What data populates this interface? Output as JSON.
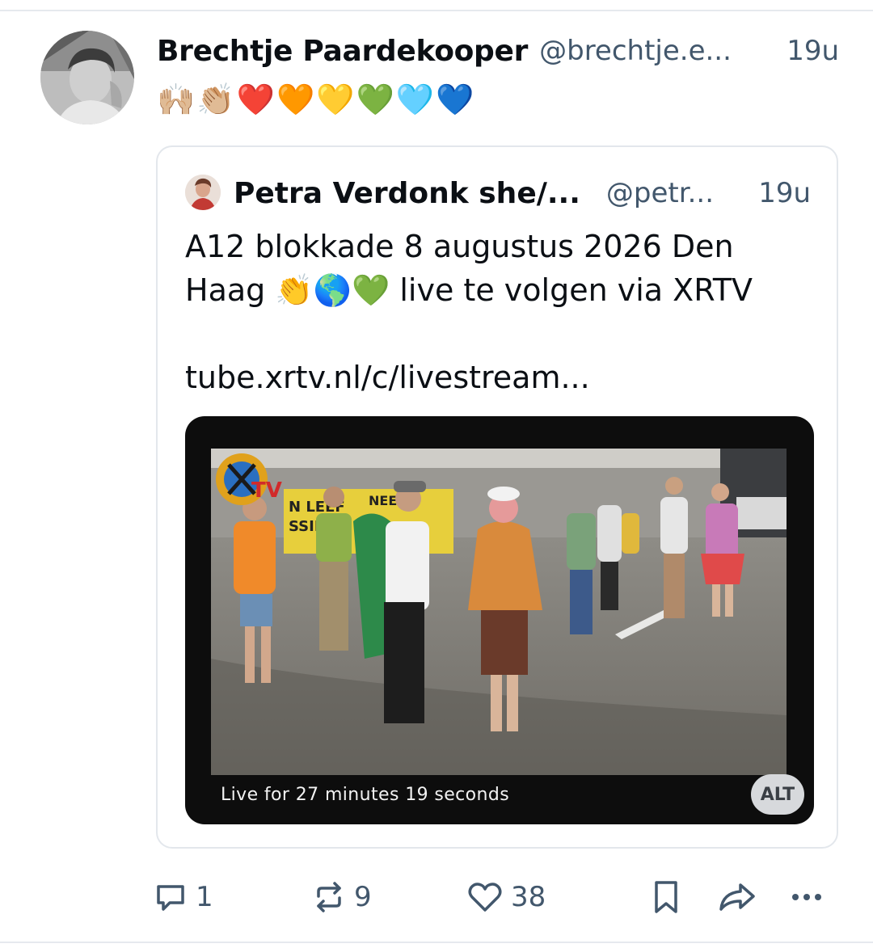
{
  "post": {
    "display_name": "Brechtje Paardekooper",
    "handle": "@brechtje.e...",
    "time": "19u",
    "text": "🙌🏼👏🏼❤️🧡💛💚🩵💙"
  },
  "quote": {
    "display_name": "Petra Verdonk she/...",
    "handle": "@petr...",
    "time": "19u",
    "text_line1": "A12 blokkade 8 augustus 2026 Den Haag 👏🌎💚 live te volgen via XRTV",
    "link": "tube.xrtv.nl/c/livestream...",
    "video": {
      "live_label": "Live for 27 minutes 19 seconds",
      "alt_label": "ALT",
      "overlay_logo": "xrtv-logo",
      "banner_text_left": "N LEEF",
      "banner_text_left2": "SSIE",
      "banner_text_right": "NEE"
    }
  },
  "actions": {
    "reply_count": "1",
    "repost_count": "9",
    "like_count": "38",
    "icons": [
      "reply-icon",
      "repost-icon",
      "heart-icon",
      "bookmark-icon",
      "share-icon",
      "more-icon"
    ]
  },
  "colors": {
    "muted_text": "#42576c",
    "border": "#e3e7ec"
  }
}
